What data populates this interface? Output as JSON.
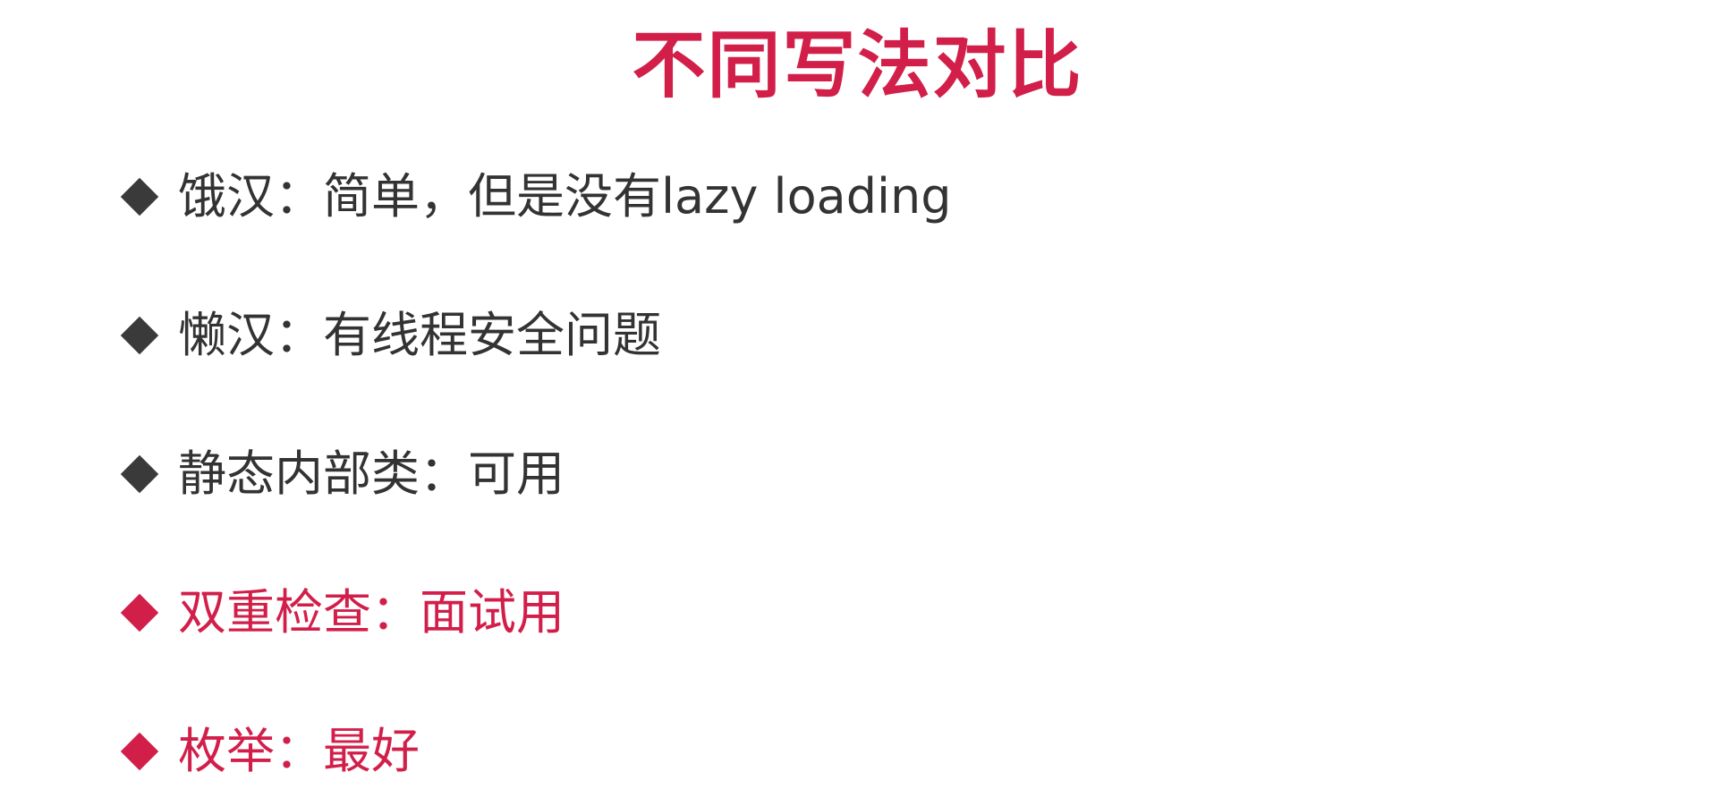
{
  "slide": {
    "title": "不同写法对比",
    "colors": {
      "accent": "#d21f4a",
      "text": "#333333",
      "bullet_dark": "#3a3a3a"
    },
    "items": [
      {
        "text": "饿汉：简单，但是没有lazy loading",
        "highlight": false
      },
      {
        "text": "懒汉：有线程安全问题",
        "highlight": false
      },
      {
        "text": "静态内部类：可用",
        "highlight": false
      },
      {
        "text": "双重检查：面试用",
        "highlight": true
      },
      {
        "text": "枚举：最好",
        "highlight": true
      }
    ]
  }
}
